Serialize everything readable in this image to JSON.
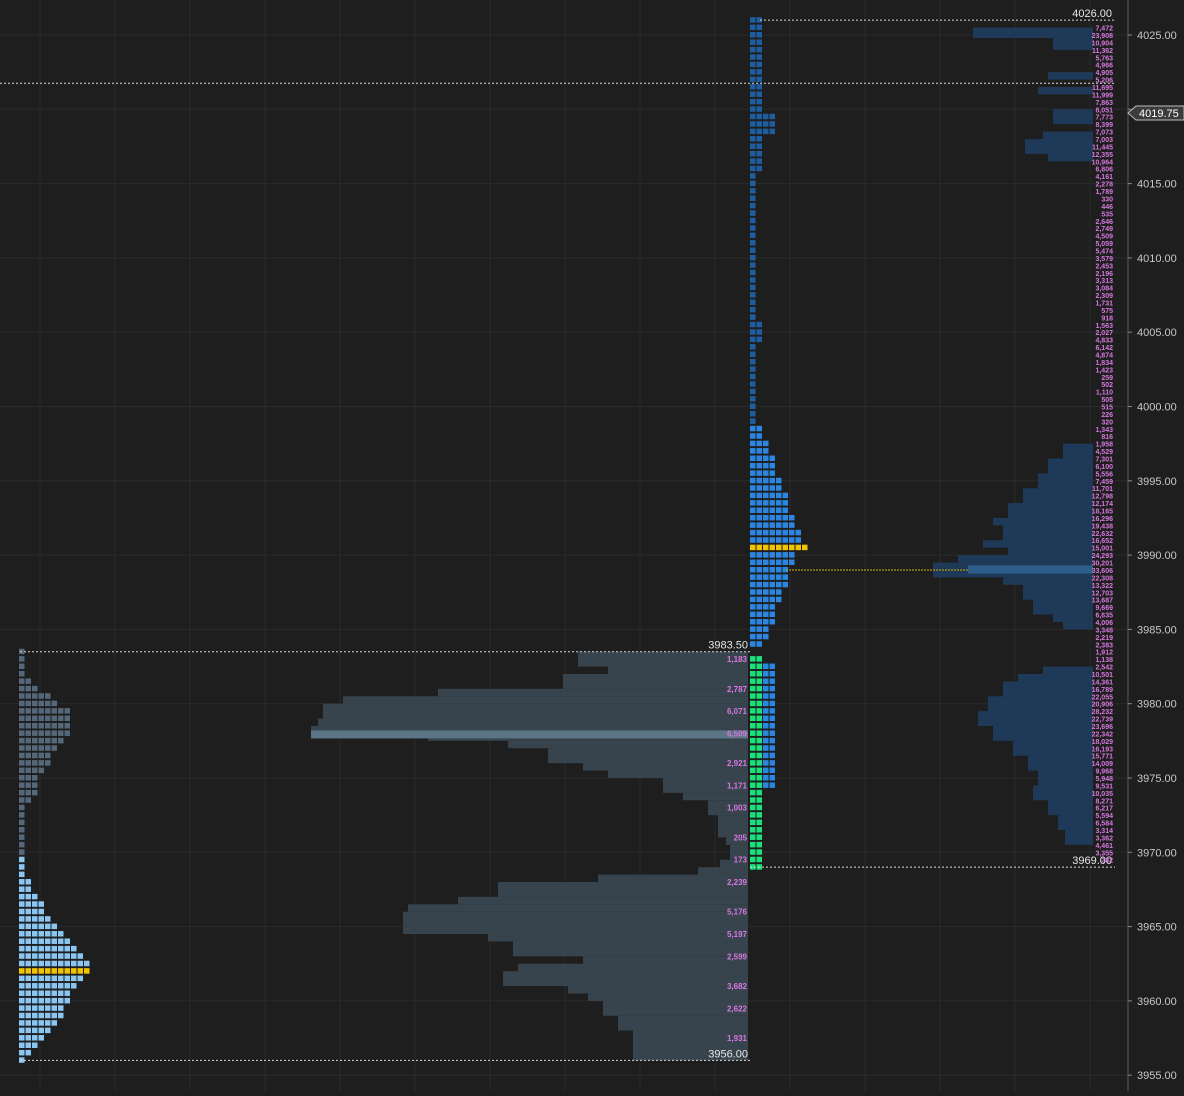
{
  "chart_data": {
    "type": "market-profile",
    "y_axis": {
      "min": 3955,
      "max": 4027,
      "tick_step": 5,
      "tick_labels": [
        "4025.00",
        "4020.00",
        "4015.00",
        "4010.00",
        "4005.00",
        "4000.00",
        "3995.00",
        "3990.00",
        "3985.00",
        "3980.00",
        "3975.00",
        "3970.00",
        "3965.00",
        "3960.00",
        "3955.00"
      ],
      "current_price": 4019.75,
      "current_price_label": "4019.75"
    },
    "grid": true,
    "reference_lines": [
      {
        "price": 4026.0,
        "label": "4026.00"
      },
      {
        "price": 3983.5,
        "label": "3983.50"
      },
      {
        "price": 3969.0,
        "label": "3969.00"
      },
      {
        "price": 3956.0,
        "label": "3956.00"
      },
      {
        "price": 4021.75,
        "label": ""
      }
    ],
    "left_profile": {
      "poc_price": 3965,
      "low": 3956.0,
      "high": 3983.5,
      "volume_labels": [
        {
          "price": 3983.0,
          "text": "1,183"
        },
        {
          "price": 3981.0,
          "text": "2,787"
        },
        {
          "price": 3979.5,
          "text": "6,071"
        },
        {
          "price": 3978.0,
          "text": "6,509"
        },
        {
          "price": 3976.0,
          "text": "2,921"
        },
        {
          "price": 3974.5,
          "text": "1,171"
        },
        {
          "price": 3973.0,
          "text": "1,003"
        },
        {
          "price": 3971.0,
          "text": "205"
        },
        {
          "price": 3969.5,
          "text": "173"
        },
        {
          "price": 3968.0,
          "text": "2,239"
        },
        {
          "price": 3966.0,
          "text": "5,176"
        },
        {
          "price": 3964.5,
          "text": "5,197"
        },
        {
          "price": 3963.0,
          "text": "2,599"
        },
        {
          "price": 3961.0,
          "text": "3,682"
        },
        {
          "price": 3959.5,
          "text": "2,622"
        },
        {
          "price": 3957.5,
          "text": "1,931"
        }
      ]
    },
    "right_profile": {
      "poc_price": 3990.5,
      "low": 3969.0,
      "high": 4026.0,
      "volume_labels": [
        "7,472",
        "23,908",
        "10,904",
        "11,362",
        "5,763",
        "4,966",
        "4,905",
        "5,206",
        "11,695",
        "11,999",
        "7,863",
        "8,051",
        "7,773",
        "8,399",
        "7,073",
        "7,003",
        "11,445",
        "12,355",
        "10,964",
        "6,806",
        "4,161",
        "2,278",
        "1,789",
        "330",
        "446",
        "535",
        "2,646",
        "2,749",
        "4,509",
        "5,059",
        "5,474",
        "3,579",
        "2,453",
        "2,196",
        "3,313",
        "3,084",
        "2,309",
        "1,731",
        "575",
        "918",
        "1,563",
        "2,027",
        "4,833",
        "6,142",
        "4,874",
        "1,834",
        "1,423",
        "259",
        "502",
        "1,110",
        "505",
        "515",
        "226",
        "320",
        "1,343",
        "816",
        "1,958",
        "4,529",
        "7,301",
        "6,100",
        "5,556",
        "7,459",
        "11,701",
        "12,798",
        "12,174",
        "18,165",
        "16,296",
        "19,438",
        "22,632",
        "16,652",
        "15,001",
        "24,293",
        "30,201",
        "33,606",
        "22,308",
        "13,322",
        "12,703",
        "13,687",
        "9,669",
        "6,635",
        "4,006",
        "3,348",
        "2,219",
        "2,383",
        "1,912",
        "1,138",
        "2,542",
        "10,501",
        "14,361",
        "16,789",
        "22,055",
        "20,906",
        "28,232",
        "22,739",
        "23,696",
        "22,342",
        "18,029",
        "16,193",
        "15,771",
        "14,009",
        "9,968",
        "5,948",
        "9,531",
        "10,035",
        "8,271",
        "6,217",
        "5,594",
        "6,584",
        "3,314",
        "3,362",
        "4,461",
        "3,355",
        "332"
      ]
    }
  }
}
